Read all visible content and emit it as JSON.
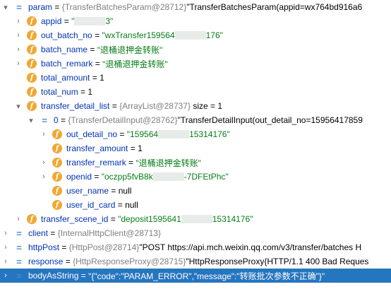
{
  "rows": [
    {
      "id": "param",
      "depth": 0,
      "toggle": "▾",
      "icon": "eq",
      "name": "param",
      "type": "{TransferBatchesParam@28712}",
      "value": "\"TransferBatchesParam(appid=wx764bd916a6",
      "vclass": "plain"
    },
    {
      "id": "appid",
      "depth": 1,
      "toggle": "›",
      "icon": "f",
      "name": "appid",
      "value_pre": "\"",
      "value_post": "3\"",
      "masked": true,
      "vclass": "str"
    },
    {
      "id": "out_batch_no",
      "depth": 1,
      "toggle": "›",
      "icon": "f",
      "name": "out_batch_no",
      "value_pre": "\"wxTransfer159564",
      "value_post": "176\"",
      "masked": true,
      "vclass": "str"
    },
    {
      "id": "batch_name",
      "depth": 1,
      "toggle": "›",
      "icon": "f",
      "name": "batch_name",
      "value": "\"退桶退押金转账\"",
      "vclass": "str"
    },
    {
      "id": "batch_remark",
      "depth": 1,
      "toggle": "›",
      "icon": "f",
      "name": "batch_remark",
      "value": "\"退桶退押金转账\"",
      "vclass": "str"
    },
    {
      "id": "total_amount",
      "depth": 1,
      "toggle": "",
      "icon": "f",
      "name": "total_amount",
      "value": "1",
      "vclass": "num"
    },
    {
      "id": "total_num",
      "depth": 1,
      "toggle": "",
      "icon": "f",
      "name": "total_num",
      "value": "1",
      "vclass": "num"
    },
    {
      "id": "transfer_detail_list",
      "depth": 1,
      "toggle": "▾",
      "icon": "f",
      "name": "transfer_detail_list",
      "type": "{ArrayList@28737}",
      "value": " size = 1",
      "vclass": "plain"
    },
    {
      "id": "item0",
      "depth": 2,
      "toggle": "▾",
      "icon": "eq",
      "name": "0",
      "type": "{TransferDetailInput@28762}",
      "value": "\"TransferDetailInput(out_detail_no=15956417859",
      "vclass": "plain"
    },
    {
      "id": "out_detail_no",
      "depth": 3,
      "toggle": "›",
      "icon": "f",
      "name": "out_detail_no",
      "value_pre": "\"159564",
      "value_post": "15314176\"",
      "masked": true,
      "vclass": "str"
    },
    {
      "id": "transfer_amount",
      "depth": 3,
      "toggle": "",
      "icon": "f",
      "name": "transfer_amount",
      "value": "1",
      "vclass": "num"
    },
    {
      "id": "transfer_remark",
      "depth": 3,
      "toggle": "›",
      "icon": "f",
      "name": "transfer_remark",
      "value": "\"退桶退押金转账\"",
      "vclass": "str"
    },
    {
      "id": "openid",
      "depth": 3,
      "toggle": "›",
      "icon": "f",
      "name": "openid",
      "value_pre": "\"oczpp5fvB8k",
      "value_post": "-7DFEtPhc\"",
      "masked": true,
      "vclass": "str"
    },
    {
      "id": "user_name",
      "depth": 3,
      "toggle": "",
      "icon": "f",
      "name": "user_name",
      "value": "null",
      "vclass": "plain"
    },
    {
      "id": "user_id_card",
      "depth": 3,
      "toggle": "",
      "icon": "f",
      "name": "user_id_card",
      "value": "null",
      "vclass": "plain"
    },
    {
      "id": "transfer_scene_id",
      "depth": 1,
      "toggle": "›",
      "icon": "f",
      "name": "transfer_scene_id",
      "value_pre": "\"deposit1595641",
      "value_post": "15314176\"",
      "masked": true,
      "vclass": "str"
    },
    {
      "id": "client",
      "depth": 0,
      "toggle": "›",
      "icon": "eq",
      "name": "client",
      "type": "{InternalHttpClient@28713}",
      "value": "",
      "vclass": "plain"
    },
    {
      "id": "httpPost",
      "depth": 0,
      "toggle": "›",
      "icon": "eq",
      "name": "httpPost",
      "type": "{HttpPost@28714}",
      "value": "\"POST https://api.mch.weixin.qq.com/v3/transfer/batches H",
      "vclass": "plain"
    },
    {
      "id": "response",
      "depth": 0,
      "toggle": "›",
      "icon": "eq",
      "name": "response",
      "type": "{HttpResponseProxy@28715}",
      "value": "\"HttpResponseProxy{HTTP/1.1 400 Bad Reques",
      "vclass": "plain"
    },
    {
      "id": "bodyAsString",
      "depth": 0,
      "toggle": "›",
      "icon": "eq",
      "name": "bodyAsString",
      "value": "\"{\"code\":\"PARAM_ERROR\",\"message\":\"转账批次参数不正确\"}\"",
      "vclass": "str",
      "selected": true
    }
  ],
  "eq_sign": " = ",
  "icons": {
    "field": "f",
    "variable": "="
  },
  "colors": {
    "name": "#0033b3",
    "string": "#067d17",
    "type": "#808080",
    "selection": "#2675bf",
    "field_badge": "#f0a732",
    "variable_icon": "#3f8fd2"
  }
}
